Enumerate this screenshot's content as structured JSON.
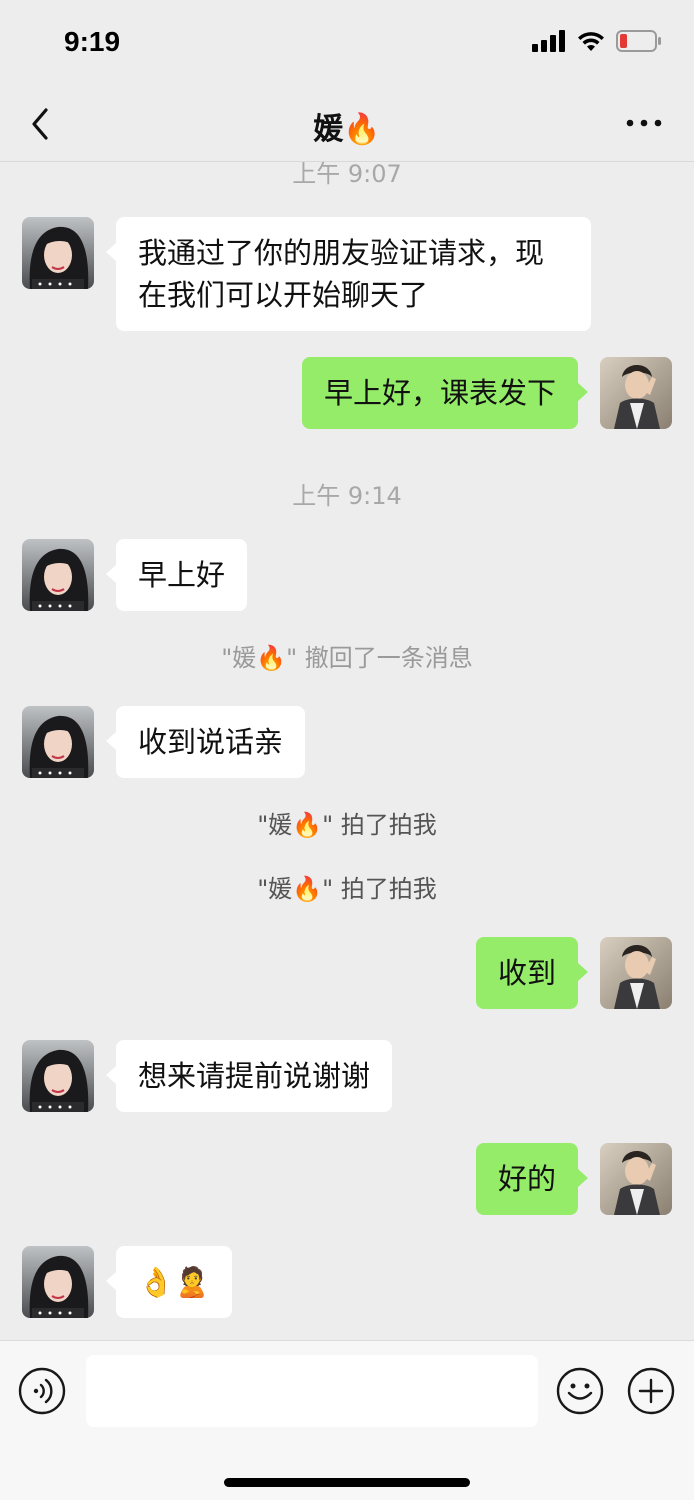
{
  "status_bar": {
    "time": "9:19"
  },
  "header": {
    "title": "媛🔥",
    "back_icon": "chevron-left-icon",
    "more_icon": "ellipsis-icon"
  },
  "chat": {
    "time_labels": [
      "上午 9:07",
      "上午 9:14"
    ],
    "messages": [
      {
        "side": "left",
        "text_line1": "我通过了你的朋友验证请求，现",
        "text_line2": "在我们可以开始聊天了"
      },
      {
        "side": "right",
        "text": "早上好，课表发下"
      },
      {
        "side": "left",
        "text": "早上好"
      },
      {
        "side": "left",
        "text": "收到说话亲"
      },
      {
        "side": "right",
        "text": "收到"
      },
      {
        "side": "left",
        "text": "想来请提前说谢谢"
      },
      {
        "side": "right",
        "text": "好的"
      },
      {
        "side": "left",
        "text": "👌🙎"
      }
    ],
    "system": {
      "recall": "\"媛🔥\" 撤回了一条消息",
      "pat1": "\"媛🔥\" 拍了拍我",
      "pat2": "\"媛🔥\" 拍了拍我"
    }
  },
  "input_bar": {
    "voice_icon": "voice-icon",
    "emoji_icon": "emoji-icon",
    "plus_icon": "plus-icon",
    "placeholder": ""
  },
  "colors": {
    "background": "#ededed",
    "bubble_self": "#95ec69",
    "bubble_other": "#ffffff",
    "battery_low": "#e53935"
  }
}
